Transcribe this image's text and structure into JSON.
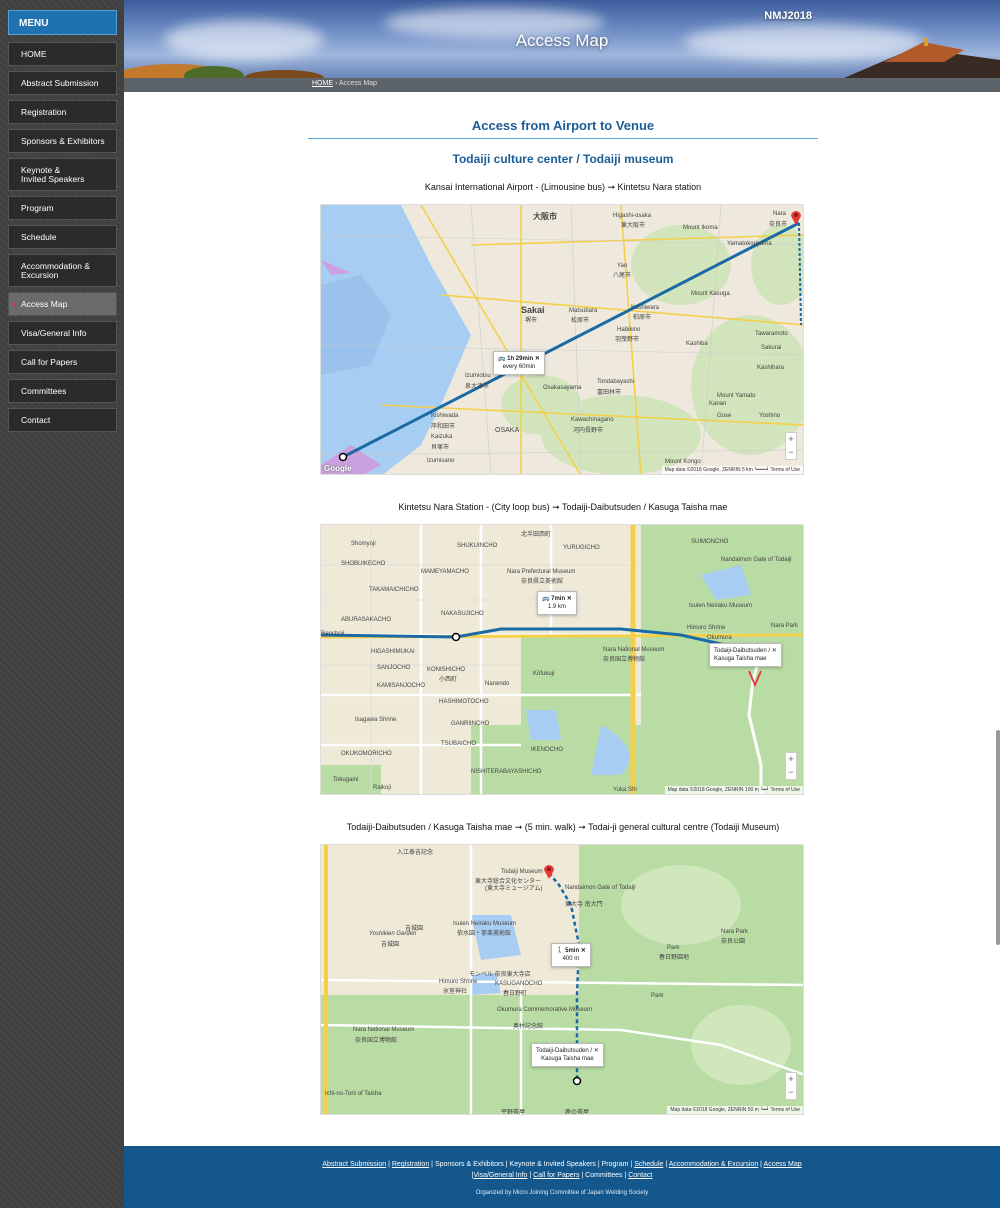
{
  "menu": {
    "title": "MENU",
    "items": [
      {
        "label": "HOME"
      },
      {
        "label": "Abstract Submission"
      },
      {
        "label": "Registration"
      },
      {
        "label": "Sponsors & Exhibitors"
      },
      {
        "label": "Keynote &\nInvited Speakers"
      },
      {
        "label": "Program"
      },
      {
        "label": "Schedule"
      },
      {
        "label": "Accommodation &\nExcursion"
      },
      {
        "label": "Access Map"
      },
      {
        "label": "Visa/General Info"
      },
      {
        "label": "Call for Papers"
      },
      {
        "label": "Committees"
      },
      {
        "label": "Contact"
      }
    ],
    "active_index": 8
  },
  "header": {
    "brand": "NMJ2018",
    "title": "Access Map"
  },
  "breadcrumb": {
    "home": "HOME",
    "sep": "›",
    "current": "Access Map"
  },
  "main": {
    "section_title": "Access from Airport to Venue",
    "venue_title": "Todaiji culture center / Todaiji museum",
    "routes": [
      {
        "label": "Kansai International Airport - (Limousine bus) ➞ Kintetsu Nara station"
      },
      {
        "label": "Kintetsu Nara Station - (City loop bus) ➞ Todaiji-Daibutsuden / Kasuga Taisha mae"
      },
      {
        "label": "Todaiji-Daibutsuden / Kasuga Taisha mae ➞ (5 min. walk) ➞ Todai-ji general cultural centre (Todaiji Museum)"
      }
    ]
  },
  "maps": [
    {
      "bubble_time": "🚌 1h 29min ✕",
      "bubble_sub": "every 60min",
      "attribution": "Map data ©2018 Google, ZENRIN   5 km ┕━━━┙   Terms of Use",
      "labels": [
        "大阪市",
        "Higashi-osaka",
        "東大阪市",
        "Nara",
        "奈良市",
        "Mount Ikoma",
        "Yamatokoriyama",
        "Yao",
        "八尾市",
        "Sakai",
        "堺市",
        "Matsubara",
        "松原市",
        "Kashiwara",
        "柏原市",
        "Habikino",
        "羽曳野市",
        "Kashiba",
        "Izumiotsu",
        "泉大津市",
        "Osakasayama",
        "Tondabayashi",
        "富田林市",
        "Kishiwada",
        "岸和田市",
        "Kaizuka",
        "貝塚市",
        "Kawachinagano",
        "河内長野市",
        "OSAKA",
        "Izumisano",
        "Gose",
        "Kanan",
        "Mount Kongo",
        "Mount Yamato",
        "Tawaramoto",
        "Mount Kasuga",
        "Yoshino",
        "Kashihara",
        "Sakurai"
      ]
    },
    {
      "bubble_time": "🚌 7min ✕",
      "bubble_sub": "1.9 km",
      "dest": "Todaiji-Daibutsuden / ✕\nKasuga Taisha mae",
      "attribution": "Map data ©2018 Google, ZENRIN   100 m ┕━┙   Terms of Use",
      "labels": [
        "SHUKUINCHO",
        "YURUGICHO",
        "北半田西町",
        "Shomyoji",
        "SHOBUIKECHO",
        "MAMEYAMACHO",
        "TAKAMAICHICHO",
        "Nara Prefectural Museum",
        "奈良県立美術館",
        "Nandaimon Gate of Todaiji",
        "SUIMONCHO",
        "Renchoji",
        "NAKASUJICHO",
        "Nara Park",
        "ABURASAKACHO",
        "Isuien Neiraku Museum",
        "Himuro Shrine",
        "Okumura",
        "Nara National Museum",
        "奈良国立博物館",
        "HIGASHIMUKAI",
        "KONISHICHO",
        "小西町",
        "Kōfukuji",
        "Nanendo",
        "SANJOCHO",
        "KAMISANJOCHO",
        "HASHIMOTOCHO",
        "Isagawa Shrine",
        "GANRIINCHO",
        "TSUBAICHO",
        "IKENOCHO",
        "OKUKOMORICHO",
        "NISHITERABAYASHICHO",
        "Tokugaini",
        "Yuka Shi",
        "Raikoji"
      ]
    },
    {
      "bubble_time": "🚶 5min ✕",
      "bubble_sub": "400 m",
      "dest": "Todaiji-Daibutsuden / ✕\nKasuga Taisha mae",
      "attribution": "Map data ©2018 Google, ZENRIN   50 m ┕━┙   Terms of Use",
      "labels": [
        "入江泰吉記念",
        "Todaiji Museum",
        "東大寺総合文化センター",
        "(東大寺ミュージアム)",
        "Nandaimon Gate of Todaiji",
        "東大寺 南大門",
        "吉城園",
        "Yoshikien Garden",
        "吉城園",
        "Isuien Neiraku Museum",
        "依水園・寧楽美術館",
        "Nara Park",
        "奈良公園",
        "Park",
        "春日野園地",
        "モンベル 奈良東大寺店",
        "Himuro Shrine",
        "氷室神社",
        "KASUGANOCHO",
        "春日野町",
        "Okumura Commemorative Museum",
        "奥村記念館",
        "Park",
        "Nara National Museum",
        "奈良国立博物館",
        "Ichi-no-Torii of Taisha",
        "平野茶屋",
        "鹿の茶屋"
      ]
    }
  ],
  "footer": {
    "links": [
      "Abstract Submission",
      "Registration",
      "Sponsors & Exhibitors",
      "Keynote & Invited Speakers",
      "Program",
      "Schedule",
      "Accommodation & Excursion",
      "Access Map",
      "Visa/General Info",
      "Call for Papers",
      "Committees",
      "Contact"
    ],
    "org": "Organized by Micro Joining Committee of Japan Welding Society"
  },
  "colors": {
    "accent": "#1c5d97",
    "sidebar": "#3f3f3f",
    "footer": "#14578c",
    "route": "#1a6aa6",
    "marker": "#e53935"
  }
}
